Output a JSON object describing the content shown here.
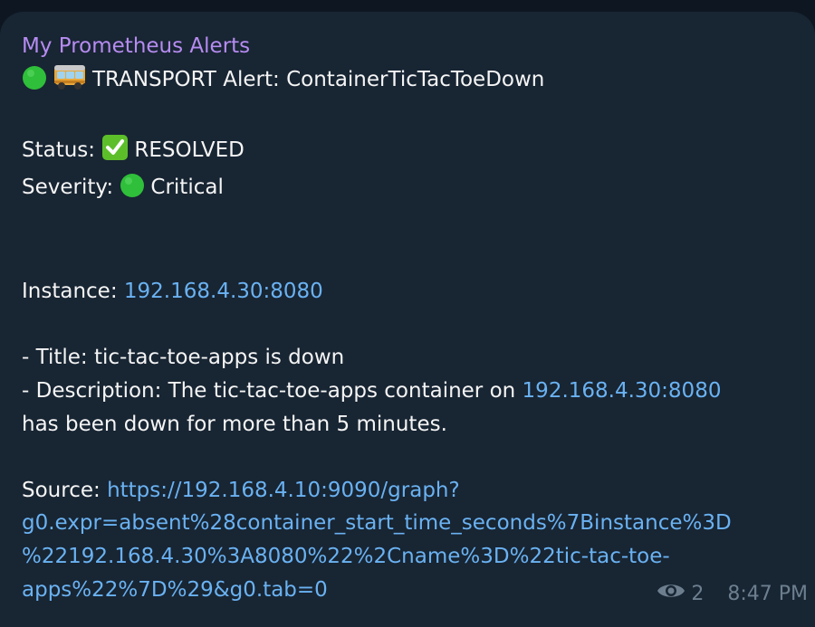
{
  "message": {
    "sender": "My Prometheus Alerts",
    "alert_title": "TRANSPORT Alert: ContainerTicTacToeDown",
    "status_label": "Status:",
    "status_value": "RESOLVED",
    "severity_label": "Severity:",
    "severity_value": "Critical",
    "instance_label": "Instance:",
    "instance_link": "192.168.4.30:8080",
    "title_line": "- Title: tic-tac-toe-apps is down",
    "description_prefix": "- Description: The tic-tac-toe-apps container on",
    "description_link": "192.168.4.30:8080",
    "description_suffix": "has been down for more than 5 minutes.",
    "source_label": "Source:",
    "source_link_lines": [
      "https://192.168.4.10:9090/graph?",
      "g0.expr=absent%28container_start_time_seconds%7Binstance%3D",
      "%22192.168.4.30%3A8080%22%2Cname%3D%22tic-tac-toe-",
      "apps%22%7D%29&g0.tab=0"
    ],
    "views": "2",
    "time": "8:47 PM"
  },
  "icons": {
    "status_dot": "green-circle-icon",
    "transport": "bus-icon",
    "resolved_check": "check-mark-button-icon",
    "severity_dot": "green-circle-icon",
    "views": "eye-icon"
  },
  "colors": {
    "background": "#0e1621",
    "bubble": "#182533",
    "sender": "#b68cf0",
    "link": "#6ab2f2",
    "text": "#f5f5f5",
    "meta": "#6d7f8f",
    "green_dot": "#2fbf3a",
    "check_box": "#5cbf2a"
  }
}
